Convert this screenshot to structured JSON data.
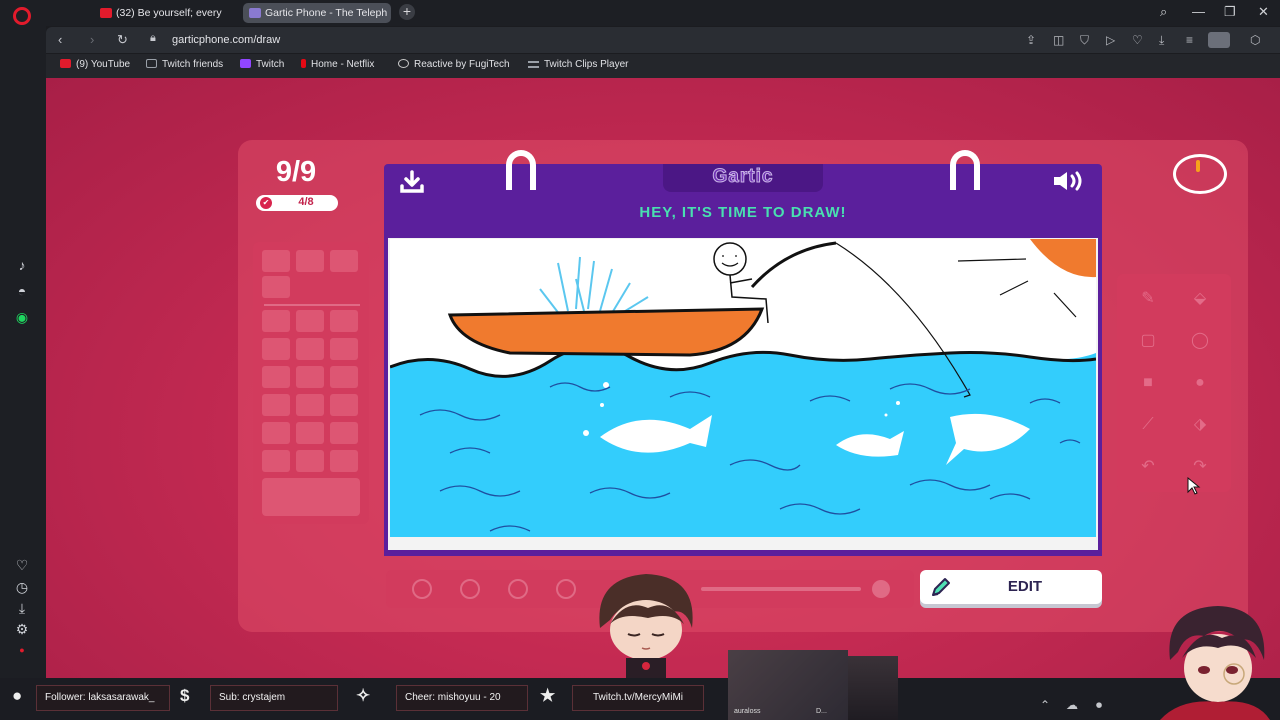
{
  "browser": {
    "tabs": [
      {
        "label": "(32) Be yourself; every",
        "muted_icon": "speaker-icon",
        "favicon": "youtube-icon",
        "favicon_color": "#e21b2c"
      },
      {
        "label": "Gartic Phone - The Teleph",
        "favicon": "phone-icon",
        "favicon_color": "#8a7ad0",
        "active": true
      }
    ],
    "new_tab": "+",
    "address": "garticphone.com/draw",
    "bookmarks": [
      {
        "label": "(9) YouTube",
        "color": "#e21b2c"
      },
      {
        "label": "Twitch friends",
        "color": "#9aa0a8"
      },
      {
        "label": "Twitch",
        "color": "#9146ff"
      },
      {
        "label": "Home - Netflix",
        "color": "#e50914"
      },
      {
        "label": "Reactive by FugiTech",
        "color": "#c8c8c8"
      },
      {
        "label": "Twitch Clips Player",
        "color": "#9aa0a8"
      }
    ]
  },
  "game": {
    "round": "9/9",
    "players": "4/8",
    "logo": "Gartic",
    "prompt": "HEY, IT'S TIME TO DRAW!",
    "edit_label": "EDIT",
    "colors": {
      "accent": "#5b1f9c",
      "prompt": "#49e0b0",
      "background": "#c42a52",
      "sea": "#33cdfc",
      "boat": "#f07a2e"
    }
  },
  "overlay": {
    "follower": "Follower: laksasarawak_",
    "sub": "Sub: crystajem",
    "cheer": "Cheer: mishoyuu - 20",
    "link": "Twitch.tv/MercyMiMi",
    "cam_label_1": "auraloss",
    "cam_label_2": "D..."
  }
}
